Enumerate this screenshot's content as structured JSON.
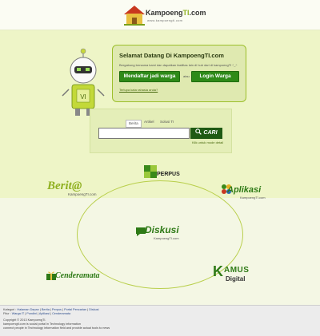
{
  "header": {
    "logo_text_main": "Kampoeng",
    "logo_text_accent": "TI",
    "logo_text_tld": ".com",
    "logo_tagline": "www.kampoengti.com"
  },
  "welcome": {
    "title": "Selamat Datang Di KampoengTI.com",
    "subtitle": "Bergabung bersama kami dan dapatkan fasilitas lain di hub dari di kampoengTI ^_^",
    "join_label": "Mendaftar jadi warga",
    "or_label": "atau",
    "login_label": "Login Warga",
    "forgot_label": "Terlupa kata rahasia anda?"
  },
  "search": {
    "tabs": [
      "Berita",
      "Artikel",
      "Solusi TI"
    ],
    "active_tab": 0,
    "input_value": "",
    "button_label": "CARI",
    "hint": "Klik untuk mode detail"
  },
  "modules": {
    "perpus": "PERPUS",
    "berita": "Berit@",
    "berita_sub": "KampoengTI.com",
    "aplikasi": "Aplikasi",
    "aplikasi_sub": "KampoengTI.com",
    "diskusi": "Diskusi",
    "diskusi_sub": "KampoengTI.com",
    "cenderamata": "Cenderamata",
    "kamus": "AMUS",
    "kamus_k": "K",
    "kamus_sub": "Digital"
  },
  "footer": {
    "line1_prefix": "Kategori :",
    "links1": [
      "Halaman Depan",
      "Berita",
      "Perpus",
      "Portal Pencarian",
      "Diskusi"
    ],
    "line2_prefix": "Fitur :",
    "links2": [
      "Warga IT",
      "Pondini",
      "Aplikasi",
      "Cenderamata"
    ],
    "copyright": "Copyright © 2013 KampoengTI.",
    "line4": "kampoengti.com is social portal in Technology information",
    "line5": "connect people in Technology information field and provide actual tools to news"
  },
  "colors": {
    "brand_green": "#2e8a18",
    "accent_lime": "#8fb020",
    "band": "#eef5c7"
  }
}
